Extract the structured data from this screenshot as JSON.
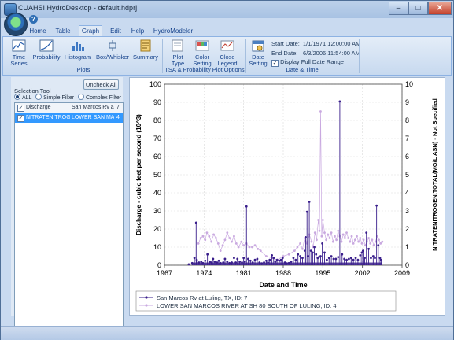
{
  "window": {
    "title": "CUAHSI HydroDesktop - default.hdprj",
    "controls": {
      "minimize": "–",
      "maximize": "□",
      "close": "✕"
    }
  },
  "qat": {
    "help_icon": "help-icon",
    "help_glyph": "?"
  },
  "tabs": [
    {
      "label": "Home"
    },
    {
      "label": "Table"
    },
    {
      "label": "Graph",
      "active": true
    },
    {
      "label": "Edit"
    },
    {
      "label": "Help"
    },
    {
      "label": "HydroModeler"
    }
  ],
  "ribbon": {
    "plots_group": {
      "label": "Plots",
      "buttons": [
        {
          "line1": "Time",
          "line2": "Series",
          "icon": "time-series-icon"
        },
        {
          "line1": "Probability",
          "line2": "",
          "icon": "probability-icon"
        },
        {
          "line1": "Histogram",
          "line2": "",
          "icon": "histogram-icon"
        },
        {
          "line1": "Box/Whisker",
          "line2": "",
          "icon": "box-whisker-icon"
        },
        {
          "line1": "Summary",
          "line2": "",
          "icon": "summary-icon"
        }
      ]
    },
    "options_group": {
      "label": "TSA & Probability Plot Options",
      "buttons": [
        {
          "line1": "Plot",
          "line2": "Type",
          "icon": "plot-type-icon"
        },
        {
          "line1": "Color",
          "line2": "Setting",
          "icon": "color-setting-icon"
        },
        {
          "line1": "Close",
          "line2": "Legend",
          "icon": "close-legend-icon"
        }
      ]
    },
    "date_group": {
      "label": "Date & Time",
      "button": {
        "line1": "Date",
        "line2": "Setting",
        "icon": "date-setting-icon"
      },
      "start_label": "Start Date:",
      "start_value": "1/1/1971 12:00:00 AM",
      "end_label": "End Date:",
      "end_value": "6/3/2006 11:54:00 AM",
      "display_full_label": "Display Full Date Range",
      "display_full_checked": true
    }
  },
  "left_panel": {
    "uncheck_all": "Uncheck All",
    "selection_tool": "Selection Tool",
    "radios": [
      {
        "label": "ALL",
        "checked": true
      },
      {
        "label": "Simple Filter",
        "checked": false
      },
      {
        "label": "Complex Filter",
        "checked": false
      }
    ],
    "rows": [
      {
        "checked": true,
        "variable": "Discharge",
        "site": "San Marcos Rv a",
        "id": "7",
        "selected": false
      },
      {
        "checked": true,
        "variable": "NITRATENITROGEN",
        "site": "LOWER SAN MARC",
        "id": "4",
        "selected": true
      }
    ]
  },
  "chart_data": {
    "type": "line",
    "xlabel": "Date and Time",
    "ylabel": "Discharge - cubic feet per second (10^3)",
    "y2label": "NITRATENITROGEN,TOTAL(MG/L ASN) - Not Specified",
    "xlim": [
      1967,
      2009
    ],
    "ylim": [
      0,
      100
    ],
    "y2lim": [
      0,
      10
    ],
    "xticks": [
      "1967",
      "1974",
      "1981",
      "1988",
      "1995",
      "2002",
      "2009"
    ],
    "yticks": [
      "0",
      "10",
      "20",
      "30",
      "40",
      "50",
      "60",
      "70",
      "80",
      "90",
      "100"
    ],
    "y2ticks": [
      "0",
      "1",
      "2",
      "3",
      "4",
      "5",
      "6",
      "7",
      "8",
      "9",
      "10"
    ],
    "grid": true,
    "legend_placement": "bottom",
    "series": [
      {
        "name": "San Marcos Rv at Luling, TX, ID: 7",
        "color": "#3a1f8c",
        "axis": "left",
        "x": [
          1971.3,
          1971.9,
          1972.3,
          1972.6,
          1972.7,
          1973.1,
          1973.5,
          1973.8,
          1974.2,
          1974.6,
          1975.0,
          1975.3,
          1975.6,
          1975.9,
          1976.3,
          1976.6,
          1976.9,
          1977.4,
          1977.7,
          1978.1,
          1978.5,
          1978.9,
          1979.3,
          1979.6,
          1979.9,
          1980.3,
          1980.7,
          1981.0,
          1981.2,
          1981.5,
          1981.8,
          1982.2,
          1982.6,
          1983.0,
          1983.4,
          1983.8,
          1984.2,
          1984.6,
          1985.0,
          1985.3,
          1985.6,
          1986.0,
          1986.3,
          1986.6,
          1986.9,
          1987.3,
          1987.6,
          1987.9,
          1988.3,
          1988.6,
          1989.0,
          1989.4,
          1989.8,
          1990.2,
          1990.6,
          1991.0,
          1991.4,
          1991.8,
          1991.95,
          1992.2,
          1992.4,
          1992.6,
          1992.9,
          1993.2,
          1993.5,
          1993.8,
          1994.1,
          1994.3,
          1994.6,
          1994.9,
          1995.3,
          1995.7,
          1996.1,
          1996.5,
          1996.9,
          1997.3,
          1997.7,
          1998.0,
          1998.4,
          1998.8,
          1999.2,
          1999.6,
          2000.0,
          2000.4,
          2000.8,
          2001.2,
          2001.6,
          2001.9,
          2002.1,
          2002.4,
          2002.7,
          2003.1,
          2003.5,
          2003.9,
          2004.2,
          2004.5,
          2004.8,
          2005.1,
          2005.3
        ],
        "y": [
          0.5,
          1.2,
          4,
          23.5,
          3,
          1.5,
          2,
          1.2,
          2.5,
          6,
          2,
          1.5,
          3.5,
          2,
          1.5,
          2.5,
          1.2,
          1.5,
          3.5,
          2,
          1.2,
          1.5,
          4,
          1.5,
          3.5,
          2,
          1.5,
          4,
          2,
          32.5,
          3.5,
          2.5,
          1.5,
          3,
          3.5,
          1.5,
          1,
          1.5,
          2.5,
          1.5,
          3,
          5.5,
          4,
          2,
          3,
          2.5,
          3,
          4,
          1.5,
          1,
          1.2,
          2,
          4,
          3,
          6,
          5,
          4,
          8,
          15.5,
          29.5,
          5,
          35,
          8,
          7,
          10,
          6,
          4,
          4.5,
          5,
          12,
          7,
          3,
          4,
          5,
          3.5,
          3.5,
          4.5,
          90.5,
          6,
          3.5,
          3,
          3.5,
          4,
          3,
          4,
          3,
          5.5,
          7,
          8,
          4,
          18,
          9,
          4,
          5,
          4,
          33,
          11,
          4,
          3
        ]
      },
      {
        "name": "LOWER SAN MARCOS RIVER AT SH 80 SOUTH OF LULING, ID: 4",
        "color": "#c9a9e0",
        "axis": "right",
        "x": [
          1973.0,
          1973.4,
          1973.8,
          1974.2,
          1974.5,
          1974.9,
          1975.3,
          1975.7,
          1976.1,
          1976.5,
          1976.9,
          1977.3,
          1977.7,
          1978.1,
          1978.5,
          1978.9,
          1979.3,
          1979.7,
          1980.1,
          1980.6,
          1981.0,
          1981.5,
          1982.0,
          1982.5,
          1983.0,
          1983.5,
          1984.0,
          1985.0,
          1986.0,
          1987.0,
          1988.0,
          1989.0,
          1990.0,
          1990.5,
          1991.0,
          1991.4,
          1991.8,
          1992.2,
          1992.6,
          1993.0,
          1993.3,
          1993.6,
          1993.9,
          1994.2,
          1994.4,
          1994.6,
          1994.8,
          1995.0,
          1995.3,
          1995.6,
          1995.9,
          1996.2,
          1996.5,
          1996.8,
          1997.1,
          1997.4,
          1997.7,
          1998.0,
          1998.3,
          1998.6,
          1998.9,
          1999.2,
          1999.5,
          1999.8,
          2000.1,
          2000.4,
          2000.7,
          2001.0,
          2001.3,
          2001.6,
          2001.9,
          2002.2,
          2002.5,
          2002.8,
          2003.1,
          2003.4,
          2003.7,
          2004.0,
          2004.3,
          2004.6,
          2004.9,
          2005.2,
          2005.5
        ],
        "y": [
          1.2,
          1.5,
          1.6,
          1.4,
          1.8,
          1.6,
          1.3,
          1.7,
          1.5,
          1.2,
          0.8,
          1.1,
          1.4,
          1.8,
          1.5,
          1.3,
          1.6,
          1.2,
          1.0,
          1.3,
          1.1,
          1.2,
          1.0,
          1.0,
          1.1,
          0.9,
          0.8,
          0.5,
          0.4,
          0.3,
          0.5,
          0.6,
          0.8,
          1.0,
          1.2,
          0.9,
          1.5,
          1.2,
          1.7,
          1.3,
          1.0,
          1.8,
          1.4,
          2.5,
          1.9,
          8.5,
          1.6,
          2.5,
          1.8,
          1.4,
          1.7,
          1.5,
          1.8,
          1.3,
          1.6,
          1.4,
          1.9,
          1.6,
          1.3,
          1.7,
          1.5,
          1.8,
          1.5,
          1.3,
          1.6,
          1.2,
          1.4,
          1.6,
          1.3,
          1.5,
          1.2,
          1.4,
          1.1,
          1.3,
          1.5,
          1.2,
          1.4,
          1.1,
          1.3,
          1.6,
          1.4,
          1.2,
          1.3
        ]
      }
    ]
  }
}
